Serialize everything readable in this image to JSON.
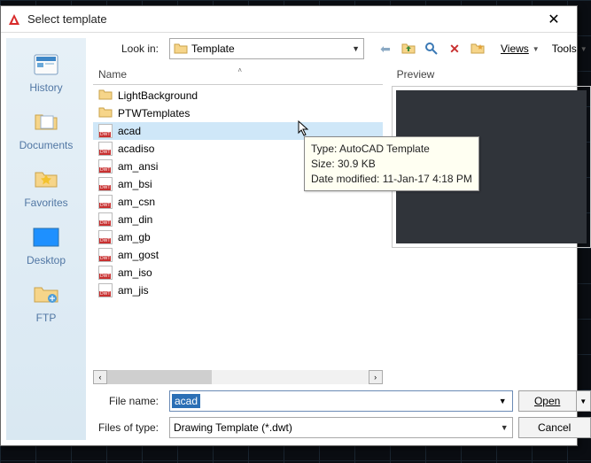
{
  "window": {
    "title": "Select template"
  },
  "lookIn": {
    "label": "Look in:",
    "value": "Template"
  },
  "toolbar": {
    "views": "Views",
    "tools": "Tools"
  },
  "places": [
    {
      "label": "History"
    },
    {
      "label": "Documents"
    },
    {
      "label": "Favorites"
    },
    {
      "label": "Desktop"
    },
    {
      "label": "FTP"
    }
  ],
  "columns": {
    "name": "Name"
  },
  "files": [
    {
      "name": "LightBackground",
      "type": "folder"
    },
    {
      "name": "PTWTemplates",
      "type": "folder"
    },
    {
      "name": "acad",
      "type": "dwt",
      "selected": true
    },
    {
      "name": "acadiso",
      "type": "dwt"
    },
    {
      "name": "am_ansi",
      "type": "dwt"
    },
    {
      "name": "am_bsi",
      "type": "dwt"
    },
    {
      "name": "am_csn",
      "type": "dwt"
    },
    {
      "name": "am_din",
      "type": "dwt"
    },
    {
      "name": "am_gb",
      "type": "dwt"
    },
    {
      "name": "am_gost",
      "type": "dwt"
    },
    {
      "name": "am_iso",
      "type": "dwt"
    },
    {
      "name": "am_jis",
      "type": "dwt"
    }
  ],
  "preview": {
    "label": "Preview"
  },
  "fileName": {
    "label": "File name:",
    "value": "acad"
  },
  "fileType": {
    "label": "Files of type:",
    "value": "Drawing Template (*.dwt)"
  },
  "buttons": {
    "open": "Open",
    "cancel": "Cancel"
  },
  "tooltip": {
    "line1": "Type: AutoCAD Template",
    "line2": "Size: 30.9 KB",
    "line3": "Date modified: 11-Jan-17 4:18 PM"
  }
}
